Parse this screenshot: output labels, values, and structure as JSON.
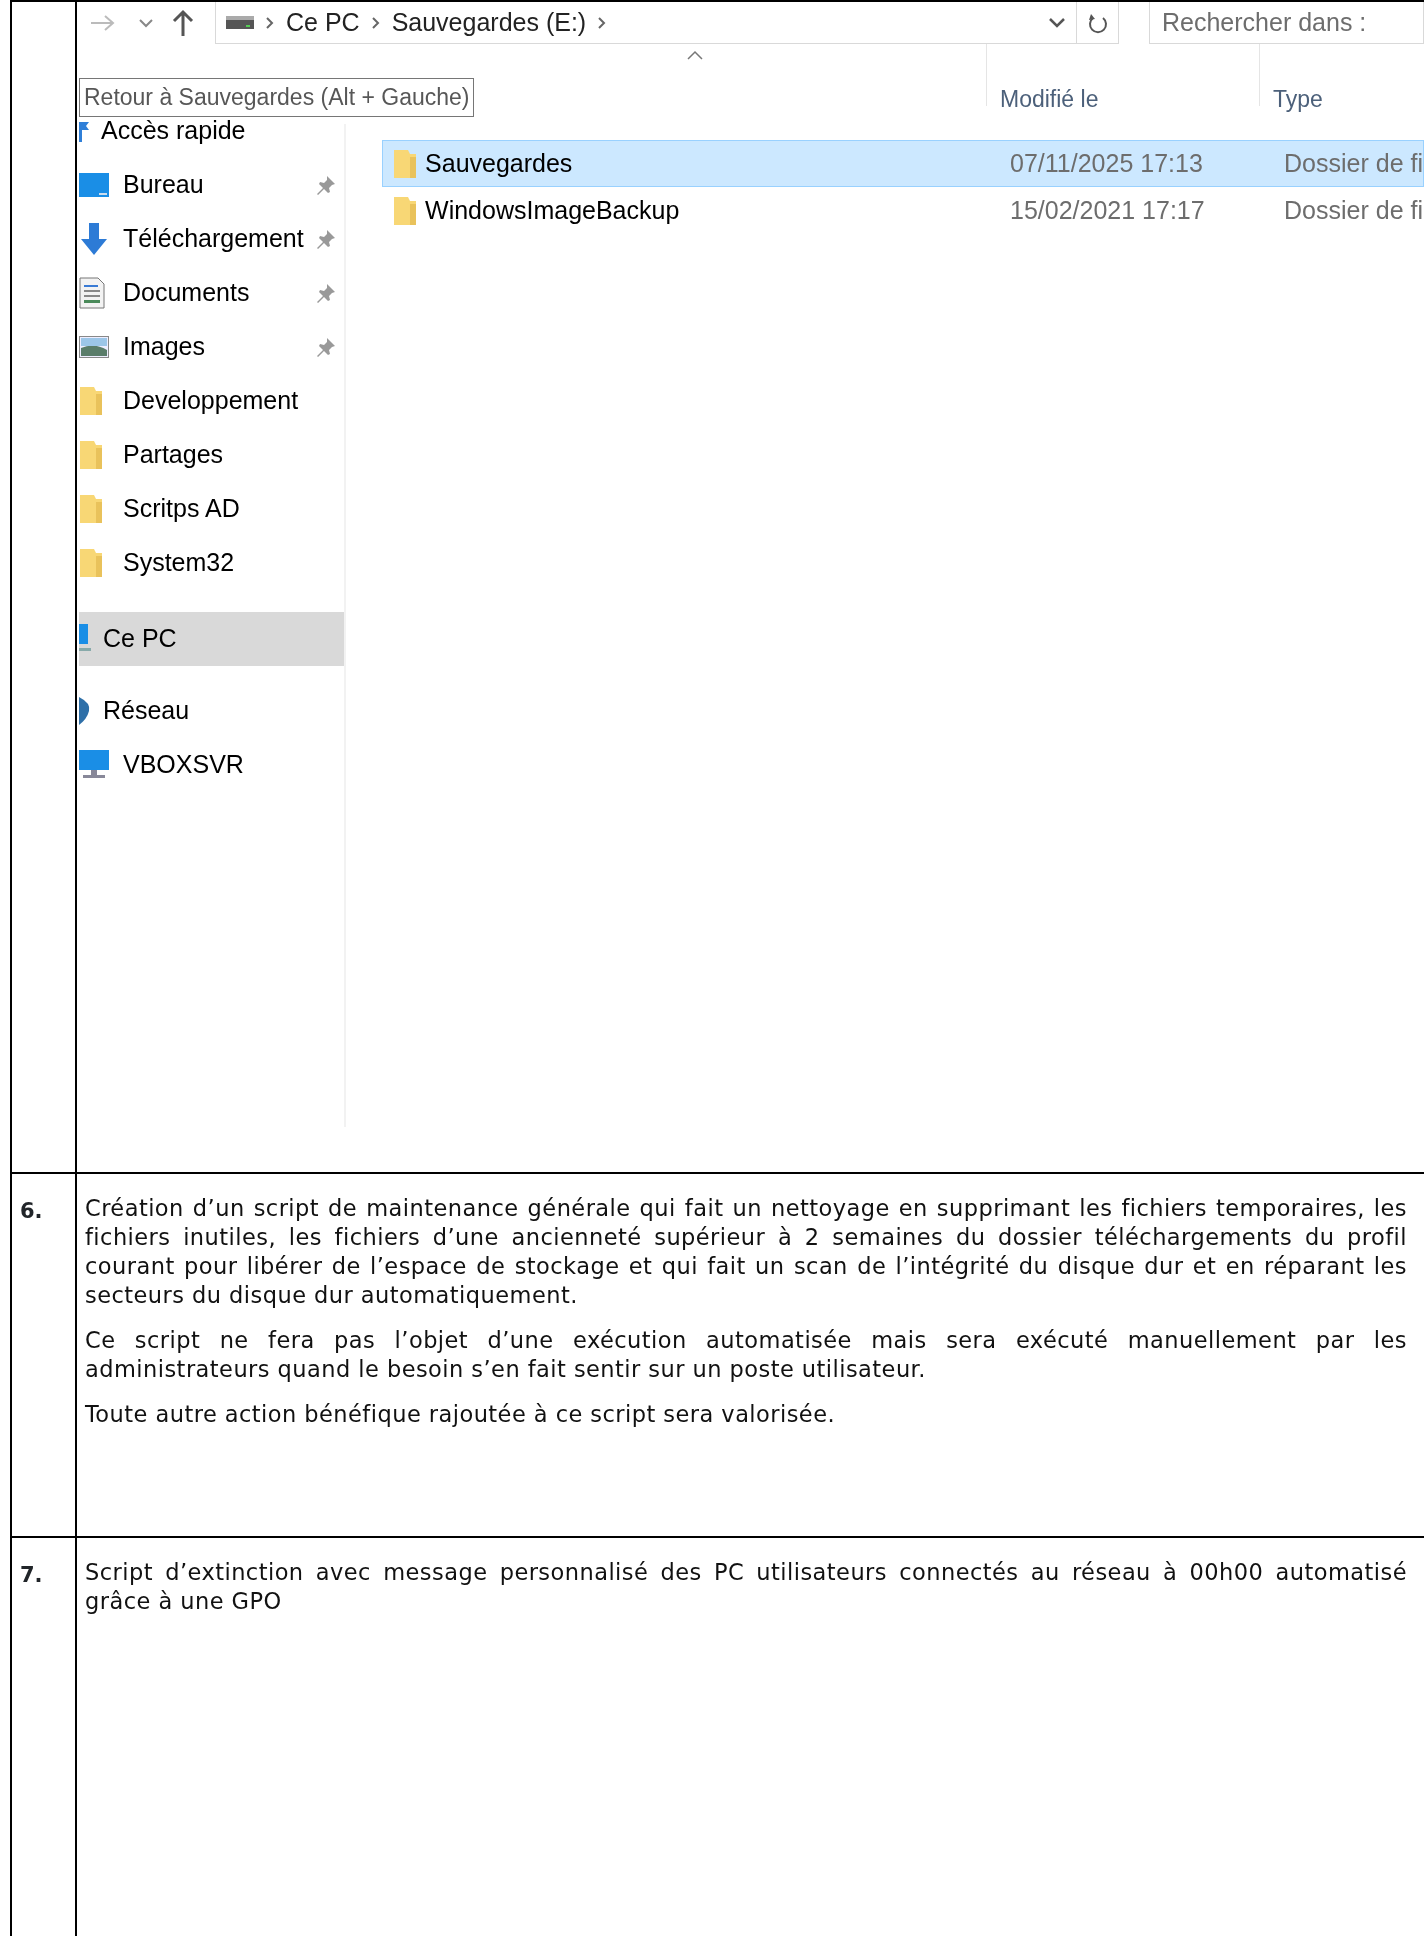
{
  "explorer": {
    "breadcrumb": [
      "Ce PC",
      "Sauvegardes (E:)"
    ],
    "search": {
      "placeholder": "Rechercher dans :"
    },
    "tooltip": "Retour à Sauvegardes (Alt + Gauche)",
    "columns": [
      "Modifié le",
      "Type"
    ],
    "sidebar": {
      "items": [
        {
          "label": "Accès rapide",
          "kind": "quick",
          "pinned": false,
          "selected": false
        },
        {
          "label": "Bureau",
          "kind": "desktop",
          "pinned": true,
          "selected": false
        },
        {
          "label": "Téléchargement",
          "kind": "download",
          "pinned": true,
          "selected": false
        },
        {
          "label": "Documents",
          "kind": "documents",
          "pinned": true,
          "selected": false
        },
        {
          "label": "Images",
          "kind": "pictures",
          "pinned": true,
          "selected": false
        },
        {
          "label": "Developpement",
          "kind": "folder",
          "pinned": false,
          "selected": false
        },
        {
          "label": "Partages",
          "kind": "folder",
          "pinned": false,
          "selected": false
        },
        {
          "label": "Scritps AD",
          "kind": "folder",
          "pinned": false,
          "selected": false
        },
        {
          "label": "System32",
          "kind": "folder",
          "pinned": false,
          "selected": false
        },
        {
          "label": "Ce PC",
          "kind": "pc",
          "pinned": false,
          "selected": true
        },
        {
          "label": "Réseau",
          "kind": "network",
          "pinned": false,
          "selected": false
        },
        {
          "label": "VBOXSVR",
          "kind": "computer",
          "pinned": false,
          "selected": false
        }
      ]
    },
    "files": [
      {
        "name": "Sauvegardes",
        "modified": "07/11/2025 17:13",
        "type": "Dossier de fi",
        "selected": true
      },
      {
        "name": "WindowsImageBackup",
        "modified": "15/02/2021 17:17",
        "type": "Dossier de fi",
        "selected": false
      }
    ]
  },
  "rows": [
    {
      "number": "6.",
      "paragraphs": [
        "Création d’un script de maintenance générale qui fait un nettoyage en supprimant les fichiers temporaires, les fichiers inutiles, les fichiers d’une ancienneté supérieur à 2 semaines du dossier téléchargements du profil courant pour libérer de l’espace de stockage et qui fait un scan de l’intégrité du disque dur et en réparant les secteurs du disque dur automatiquement.",
        "Ce script ne fera pas l’objet d’une exécution automatisée mais sera exécuté manuellement par les administrateurs quand le besoin s’en fait sentir sur un poste utilisateur.",
        "Toute autre action bénéfique rajoutée à ce script sera valorisée."
      ]
    },
    {
      "number": "7.",
      "paragraphs": [
        "Script d’extinction avec message personnalisé des PC utilisateurs connectés au réseau à 00h00 automatisé grâce à une GPO"
      ]
    }
  ]
}
